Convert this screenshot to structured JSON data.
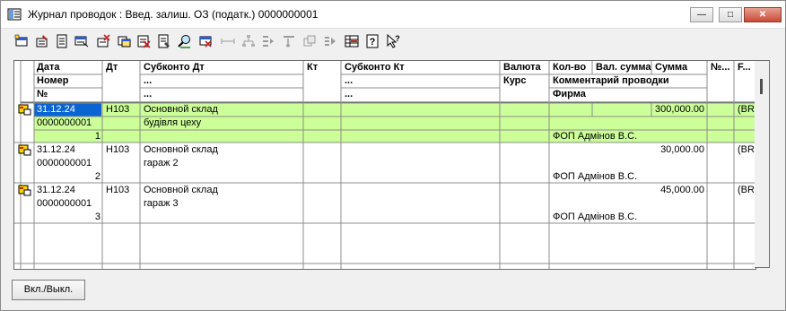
{
  "window": {
    "title": "Журнал проводок : Введ. залиш. ОЗ (податк.) 0000000001"
  },
  "title_buttons": {
    "minimize": "—",
    "maximize": "□",
    "close": "✕"
  },
  "toolbar": {
    "icons": [
      "add-icon",
      "edit-icon",
      "doc-icon",
      "copy-icon",
      "delete-icon",
      "filter-icon",
      "mark-delete-icon",
      "report-icon",
      "find-icon",
      "cancel-find-icon",
      "spacer-icon",
      "tree-icon",
      "move-up-icon",
      "move-down-icon",
      "level-icon",
      "next-icon",
      "grid-icon",
      "help-icon",
      "whatis-icon"
    ]
  },
  "grid": {
    "headers": {
      "row1": {
        "date": "Дата",
        "dt": "Дт",
        "subconto_dt": "Субконто Дт",
        "kt": "Кт",
        "subconto_kt": "Субконто Кт",
        "currency": "Валюта",
        "qty": "Кол-во",
        "cur_sum": "Вал. сумма",
        "sum": "Сумма",
        "no": "№...",
        "f": "F..."
      },
      "row2": {
        "number": "Номер",
        "subconto_dt": "...",
        "subconto_kt": "...",
        "rate": "Курс",
        "comment": "Комментарий проводки"
      },
      "row3": {
        "no": "№",
        "subconto_dt": "...",
        "subconto_kt": "...",
        "firm": "Фирма"
      }
    },
    "rows": [
      {
        "date": "31.12.24",
        "number": "0000000001",
        "index": "1",
        "dt": "H103",
        "sub1": "Основной склад",
        "sub2": "будівля цеху",
        "sum": "300,000.00",
        "firm": "ФОП Адмінов В.С.",
        "f": "(ВR"
      },
      {
        "date": "31.12.24",
        "number": "0000000001",
        "index": "2",
        "dt": "H103",
        "sub1": "Основной склад",
        "sub2": "гараж 2",
        "sum": "30,000.00",
        "firm": "ФОП Адмінов В.С.",
        "f": "(ВR"
      },
      {
        "date": "31.12.24",
        "number": "0000000001",
        "index": "3",
        "dt": "H103",
        "sub1": "Основной склад",
        "sub2": "гараж 3",
        "sum": "45,000.00",
        "firm": "ФОП Адмінов В.С.",
        "f": "(ВR"
      }
    ]
  },
  "buttons": {
    "on_off": "Вкл./Выкл."
  },
  "colors": {
    "selected_row": "#ccff99",
    "selected_cell": "#0a64d2",
    "grid_line": "#8c8c8c"
  }
}
